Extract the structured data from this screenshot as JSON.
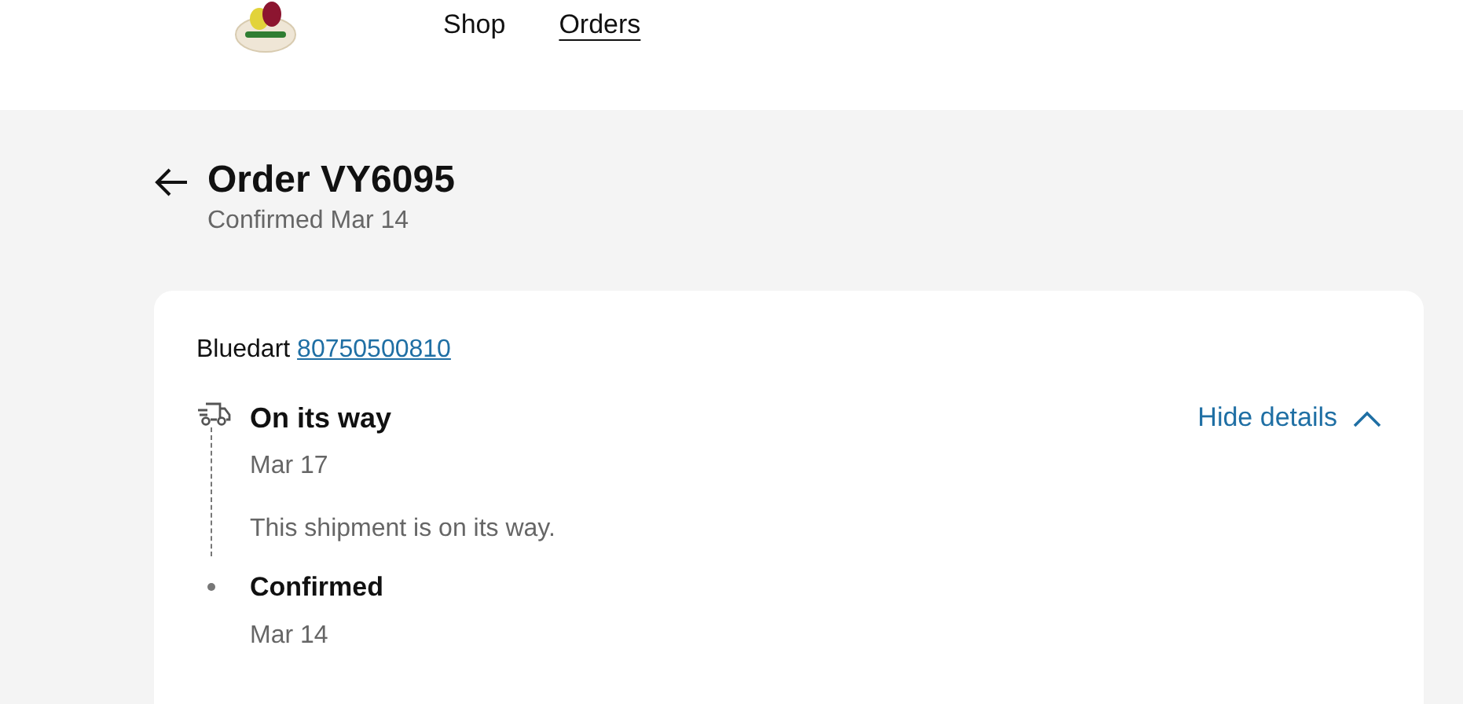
{
  "nav": [
    {
      "label": "Shop",
      "selected": false
    },
    {
      "label": "Orders",
      "selected": true
    }
  ],
  "order": {
    "title": "Order VY6095",
    "subtitle": "Confirmed Mar 14"
  },
  "shipment": {
    "carrier": "Bluedart",
    "tracking": "80750500810",
    "toggle": "Hide details",
    "expanded": true,
    "events": [
      {
        "kind": "current",
        "title": "On its way",
        "date": "Mar 17",
        "note": "This shipment is on its way."
      },
      {
        "kind": "past",
        "title": "Confirmed",
        "date": "Mar 14"
      }
    ]
  }
}
